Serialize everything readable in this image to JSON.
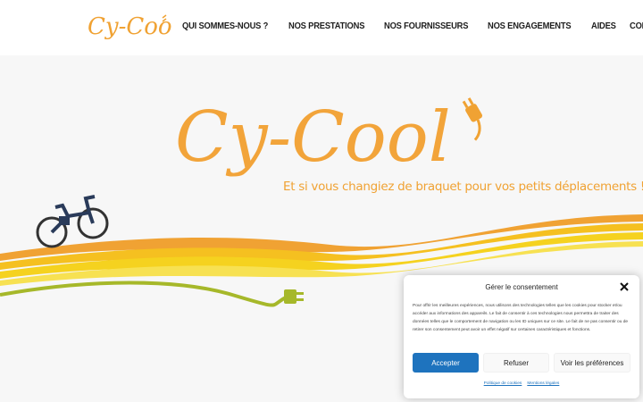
{
  "header": {
    "logo_text": "Cy-Cool",
    "nav": [
      "QUI SOMMES-NOUS ?",
      "NOS PRESTATIONS",
      "NOS FOURNISSEURS",
      "NOS ENGAGEMENTS",
      "AIDES",
      "CONTACT"
    ]
  },
  "hero": {
    "logo_text": "Cy-Cool",
    "tagline": "Et si vous changiez de braquet pour vos petits déplacements !"
  },
  "consent": {
    "title": "Gérer le consentement",
    "body": "Pour offrir les meilleures expériences, nous utilisons des technologies telles que les cookies pour stocker et/ou accéder aux informations des appareils. Le fait de consentir à ces technologies nous permettra de traiter des données telles que le comportement de navigation ou les ID uniques sur ce site. Le fait de ne pas consentir ou de retirer son consentement peut avoir un effet négatif sur certaines caractéristiques et fonctions.",
    "accept_label": "Accepter",
    "refuse_label": "Refuser",
    "prefs_label": "Voir les préférences",
    "links": [
      "Politique de cookies",
      "Mentions légales"
    ]
  },
  "colors": {
    "orange": "#f0a233",
    "yellow": "#f5d21f",
    "green": "#a6b82a",
    "accent_blue": "#1e73be"
  },
  "icons": [
    "plug-icon",
    "bicycle-icon",
    "close-icon"
  ]
}
